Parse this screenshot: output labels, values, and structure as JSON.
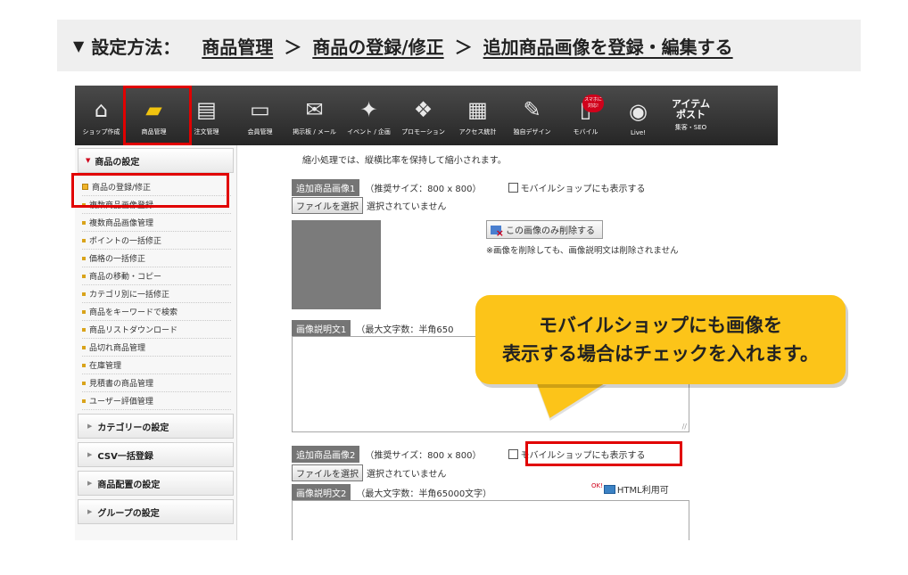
{
  "instruction": {
    "marker": "▼",
    "label": "設定方法：",
    "steps": [
      "商品管理",
      "商品の登録/修正",
      "追加商品画像を登録・編集する"
    ],
    "separator": "＞"
  },
  "topnav": {
    "items": [
      {
        "label": "ショップ作成",
        "icon": "shop-icon"
      },
      {
        "label": "商品管理",
        "icon": "product-box-icon"
      },
      {
        "label": "注文管理",
        "icon": "order-icon"
      },
      {
        "label": "会員管理",
        "icon": "member-card-icon"
      },
      {
        "label": "掲示板 / メール",
        "icon": "mail-icon"
      },
      {
        "label": "イベント / 企画",
        "icon": "event-icon"
      },
      {
        "label": "プロモーション",
        "icon": "gift-icon"
      },
      {
        "label": "アクセス統計",
        "icon": "chart-icon"
      },
      {
        "label": "独自デザイン",
        "icon": "palette-icon"
      },
      {
        "label": "モバイル",
        "icon": "mobile-icon"
      },
      {
        "label": "Live!",
        "icon": "live-icon"
      }
    ],
    "mobile_badge": "スマホに対応!",
    "post": {
      "line1": "アイテム",
      "line2": "ポスト",
      "sub": "集客・SEO"
    }
  },
  "sidebar": {
    "header": "商品の設定",
    "items": [
      "商品の登録/修正",
      "複数商品画像登録",
      "複数商品画像管理",
      "ポイントの一括修正",
      "価格の一括修正",
      "商品の移動・コピー",
      "カテゴリ別に一括修正",
      "商品をキーワードで検索",
      "商品リストダウンロード",
      "品切れ商品管理",
      "在庫管理",
      "見積書の商品管理",
      "ユーザー評価管理"
    ],
    "sections": [
      "カテゴリーの設定",
      "CSV一括登録",
      "商品配置の設定",
      "グループの設定"
    ]
  },
  "main": {
    "note": "縮小処理では、縦横比率を保持して縮小されます。",
    "image1": {
      "tag": "追加商品画像1",
      "size_hint": "（推奨サイズ：800 x 800）",
      "mobile_label": "モバイルショップにも表示する",
      "file_button": "ファイルを選択",
      "file_status": "選択されていません",
      "delete_button": "この画像のみ削除する",
      "delete_note": "※画像を削除しても、画像説明文は削除されません",
      "desc_tag": "画像説明文1",
      "desc_hint": "（最大文字数：半角650"
    },
    "image2": {
      "tag": "追加商品画像2",
      "size_hint": "（推奨サイズ：800 x 800）",
      "mobile_label": "モバイルショップにも表示する",
      "file_button": "ファイルを選択",
      "file_status": "選択されていません",
      "desc_tag": "画像説明文2",
      "desc_hint": "（最大文字数：半角65000文字）",
      "html_ok_badge": "OK!",
      "html_ok": "HTML利用可"
    }
  },
  "callout": {
    "line1": "モバイルショップにも画像を",
    "line2": "表示する場合はチェックを入れます。"
  },
  "colors": {
    "highlight": "#e10000",
    "callout": "#fcc419",
    "nav_bg": "#333333",
    "tag_bg": "#757575"
  }
}
